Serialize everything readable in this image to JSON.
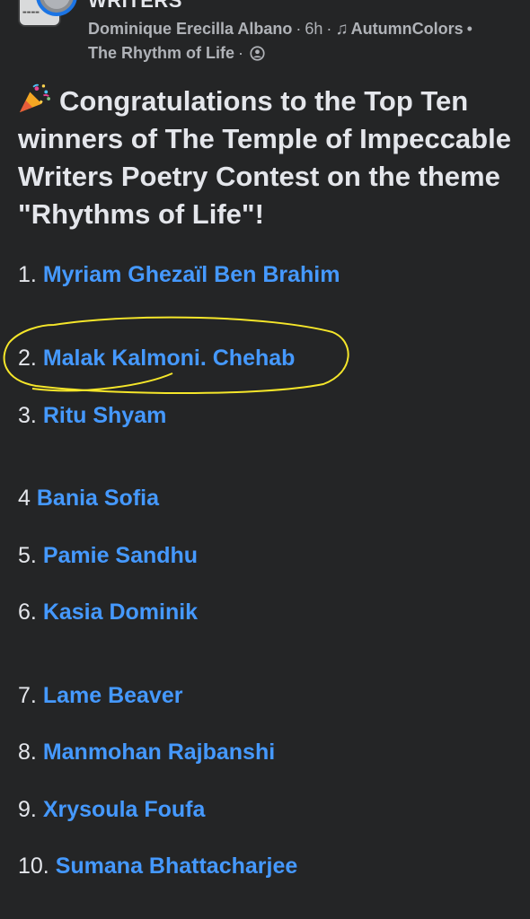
{
  "post": {
    "group_name": "WRITERS",
    "author": "Dominique Erecilla Albano",
    "time": "6h",
    "music_label": "AutumnColors",
    "song_title": "The Rhythm of Life"
  },
  "headline": "Congratulations to the Top Ten winners of The Temple of Impeccable Writers Poetry Contest on the theme \"Rhythms of Life\"!",
  "winners": [
    {
      "num": "1.",
      "name": "Myriam Ghezaïl Ben Brahim"
    },
    {
      "num": "2.",
      "name": "Malak Kalmoni. Chehab"
    },
    {
      "num": "3.",
      "name": "Ritu Shyam"
    },
    {
      "num": "4",
      "name": "Bania Sofia"
    },
    {
      "num": "5.",
      "name": "Pamie Sandhu"
    },
    {
      "num": "6.",
      "name": "Kasia Dominik"
    },
    {
      "num": "7.",
      "name": "Lame Beaver"
    },
    {
      "num": "8.",
      "name": "Manmohan Rajbanshi"
    },
    {
      "num": "9.",
      "name": "Xrysoula Foufa"
    },
    {
      "num": "10.",
      "name": "Sumana Bhattacharjee"
    }
  ],
  "colors": {
    "background": "#242526",
    "link": "#4599ff",
    "highlight_circle": "#f5e62a"
  },
  "icons": {
    "party": "party-popper-icon",
    "music": "music-note-icon",
    "audience": "audience-globe-icon"
  }
}
